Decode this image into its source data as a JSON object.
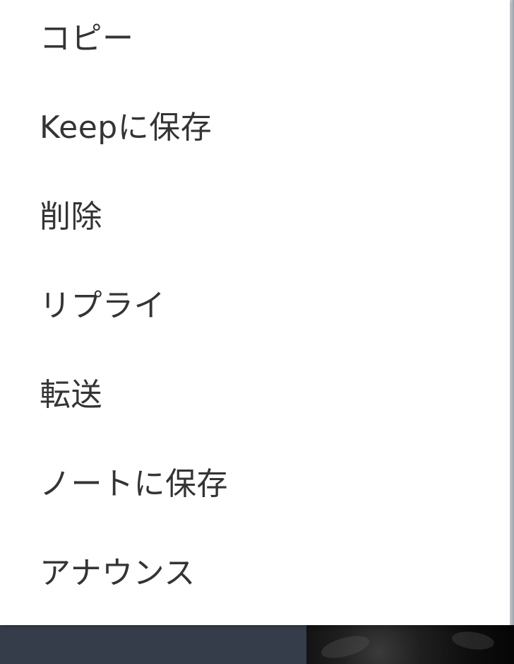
{
  "context_menu": {
    "items": [
      {
        "label": "コピー"
      },
      {
        "label": "Keepに保存"
      },
      {
        "label": "削除"
      },
      {
        "label": "リプライ"
      },
      {
        "label": "転送"
      },
      {
        "label": "ノートに保存"
      },
      {
        "label": "アナウンス"
      }
    ]
  },
  "colors": {
    "menu_background": "#ffffff",
    "menu_text": "#343434",
    "footer_bar": "#353d4b"
  }
}
